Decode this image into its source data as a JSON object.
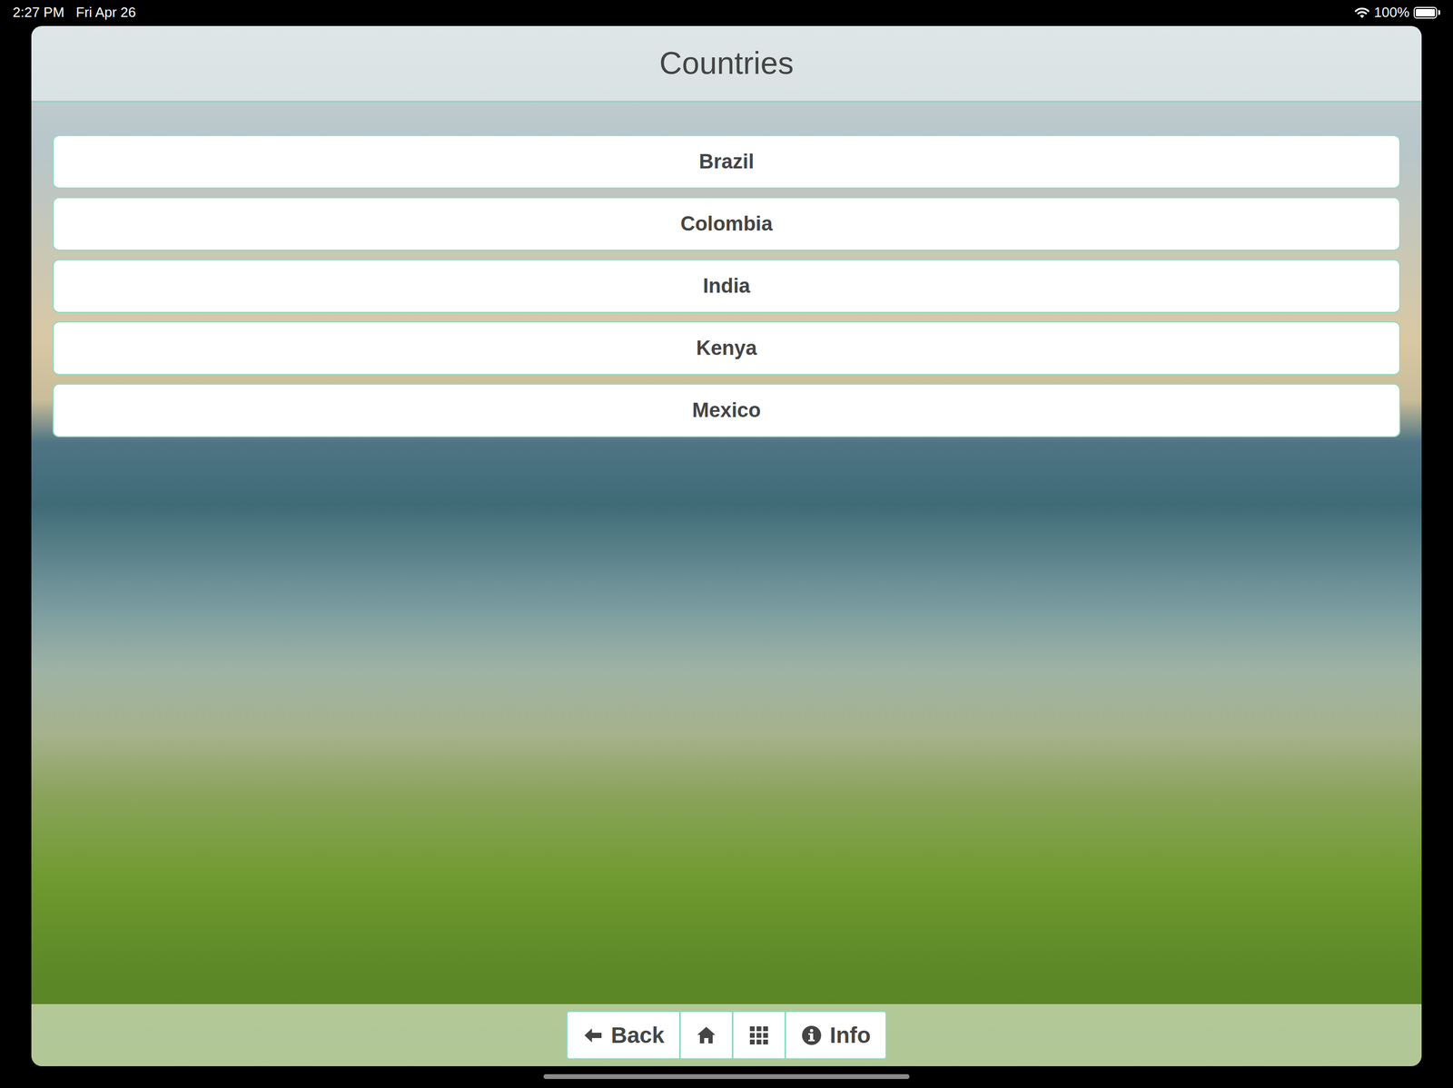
{
  "status_bar": {
    "time": "2:27 PM",
    "date": "Fri Apr 26",
    "battery": "100%",
    "battery_level": 1.0
  },
  "header": {
    "title": "Countries"
  },
  "countries": [
    {
      "label": "Brazil"
    },
    {
      "label": "Colombia"
    },
    {
      "label": "India"
    },
    {
      "label": "Kenya"
    },
    {
      "label": "Mexico"
    }
  ],
  "toolbar": [
    {
      "kind": "back",
      "label": "Back"
    },
    {
      "kind": "home"
    },
    {
      "kind": "apps"
    },
    {
      "kind": "info",
      "label": "Info"
    }
  ]
}
